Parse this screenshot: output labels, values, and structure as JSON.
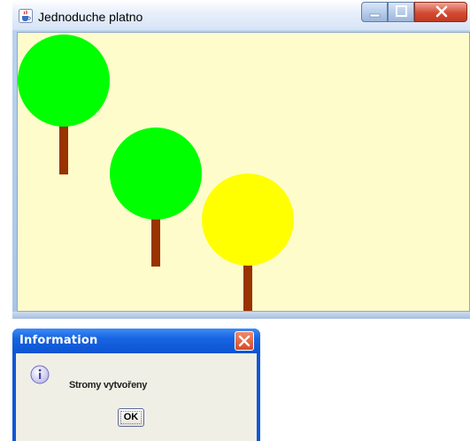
{
  "main_window": {
    "title": "Jednoduche platno",
    "icon": "java-cup-icon",
    "buttons": [
      "minimize-icon",
      "maximize-icon",
      "close-icon"
    ],
    "canvas_background": "#fffccc",
    "trees": [
      {
        "name": "tree-1",
        "crown_color": "#00ff00",
        "trunk_color": "#993300"
      },
      {
        "name": "tree-2",
        "crown_color": "#00ff00",
        "trunk_color": "#993300"
      },
      {
        "name": "tree-3",
        "crown_color": "#ffff00",
        "trunk_color": "#993300"
      }
    ]
  },
  "dialog": {
    "title": "Information",
    "icon": "info-icon",
    "message": "Stromy vytvořeny",
    "ok_label": "OK",
    "title_bar_color": "#0f56d6"
  }
}
